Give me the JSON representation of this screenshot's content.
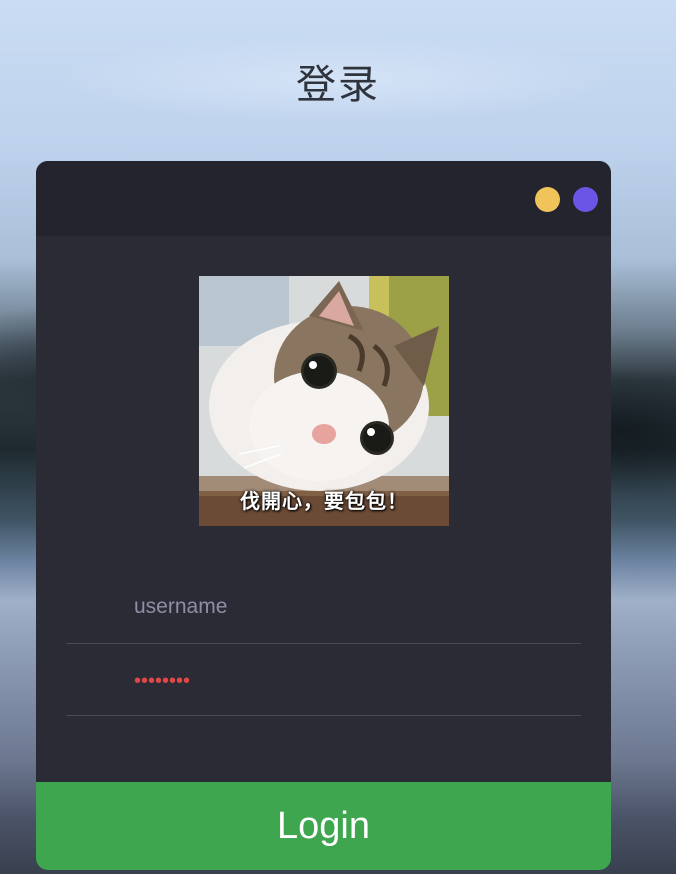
{
  "page": {
    "title": "登录"
  },
  "window_controls": {
    "dot_colors": [
      "#f0c35b",
      "#6a55e6"
    ]
  },
  "avatar": {
    "icon": "cat-photo",
    "caption": "伐開心，要包包！"
  },
  "form": {
    "username": {
      "placeholder": "username",
      "value": ""
    },
    "password": {
      "value": "••••••••"
    },
    "login_label": "Login"
  },
  "colors": {
    "card_bg": "#2b2b36",
    "header_bg": "#24242e",
    "login_button": "#3da64f",
    "password_text": "#e04848"
  }
}
